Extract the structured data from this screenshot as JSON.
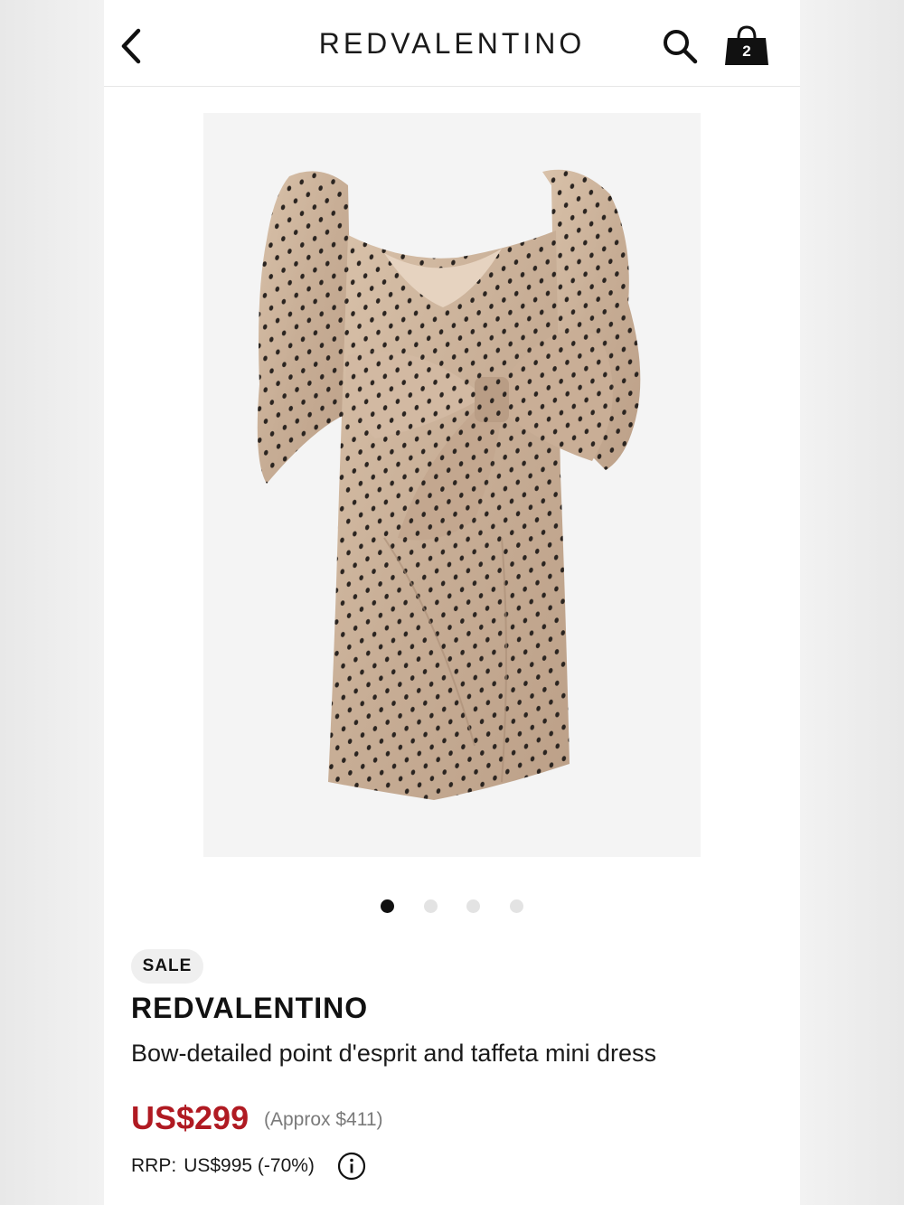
{
  "header": {
    "brand_logo": "REDVALENTINO",
    "cart_count": "2",
    "icons": [
      "chevron-left-icon",
      "search-icon",
      "shopping-bag-icon"
    ]
  },
  "gallery": {
    "image_alt": "Bow-detailed point d'esprit and taffeta mini dress",
    "image_count": 4,
    "active_index": 0
  },
  "product": {
    "badge": "SALE",
    "brand": "REDVALENTINO",
    "title": "Bow-detailed point d'esprit and taffeta mini dress",
    "price": "US$299",
    "approx_price": "(Approx $411)",
    "rrp_label": "RRP:",
    "rrp_value": "US$995 (-70%)"
  },
  "colors": {
    "sale_price": "#b01a22",
    "badge_bg": "#efefef",
    "dress_fabric": "#cdb39c",
    "dress_dots": "#2a2420"
  }
}
